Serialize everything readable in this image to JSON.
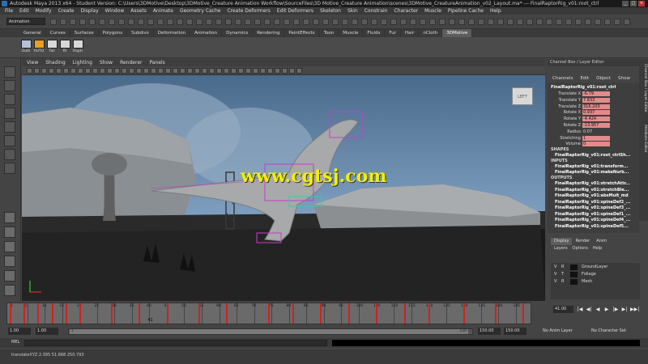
{
  "titlebar": {
    "title": "Autodesk Maya 2013 x64 - Student Version: C:\\Users\\3DMotive\\Desktop\\3DMotive_Creature Animation Workflow\\SourceFiles\\3D Motive_Creature Animation\\scenes\\3DMotive_CreatureAnimation_v02_Layout.ma* --- FinalRaptorRig_v01:root_ctrl"
  },
  "menubar": [
    "File",
    "Edit",
    "Modify",
    "Create",
    "Display",
    "Window",
    "Assets",
    "Animate",
    "Geometry Cache",
    "Create Deformers",
    "Edit Deformers",
    "Skeleton",
    "Skin",
    "Constrain",
    "Character",
    "Muscle",
    "Pipeline Cache",
    "Help"
  ],
  "statusline": {
    "mode": "Animation"
  },
  "shelf_tabs": [
    "General",
    "Curves",
    "Surfaces",
    "Polygons",
    "Subdivs",
    "Deformation",
    "Animation",
    "Dynamics",
    "Rendering",
    "PaintEffects",
    "Toon",
    "Muscle",
    "Fluids",
    "Fur",
    "Hair",
    "nCloth",
    "3DMotive"
  ],
  "shelf_active_tab": "3DMotive",
  "shelf_buttons": [
    {
      "label": "Outli",
      "color": "#b5c2d6"
    },
    {
      "label": "AUTO",
      "color": "#e8a020"
    },
    {
      "label": "Tail",
      "color": "#d8d8d8"
    },
    {
      "label": "fit",
      "color": "#d8d8d8"
    },
    {
      "label": "Rapti",
      "color": "#d8d8d8"
    }
  ],
  "viewport": {
    "menu": [
      "View",
      "Shading",
      "Lighting",
      "Show",
      "Renderer",
      "Panels"
    ],
    "view_cube_label": "LEFT",
    "watermark": "www.cgtsj.com"
  },
  "channel_box": {
    "title": "Channel Box / Layer Editor",
    "menu": [
      "Channels",
      "Edit",
      "Object",
      "Show"
    ],
    "node": "FinalRaptorRig_v01:root_ctrl",
    "attributes": [
      {
        "name": "Translate X",
        "value": "-6.79",
        "keyed": true
      },
      {
        "name": "Translate Y",
        "value": "7.833",
        "keyed": true
      },
      {
        "name": "Translate Z",
        "value": "316.203",
        "keyed": true
      },
      {
        "name": "Rotate X",
        "value": "0.937",
        "keyed": true
      },
      {
        "name": "Rotate Y",
        "value": "-4.424",
        "keyed": true
      },
      {
        "name": "Rotate Z",
        "value": "-13.957",
        "keyed": true
      },
      {
        "name": "Radius",
        "value": "0.07",
        "keyed": false
      },
      {
        "name": "Stretching",
        "value": "1",
        "keyed": true
      },
      {
        "name": "Volume",
        "value": "0",
        "keyed": true
      }
    ],
    "shapes_label": "SHAPES",
    "shapes": [
      "FinalRaptorRig_v01:root_ctrlSh..."
    ],
    "inputs_label": "INPUTS",
    "inputs": [
      "FinalRaptorRig_v01:transform...",
      "FinalRaptorRig_v01:makeNurb..."
    ],
    "outputs_label": "OUTPUTS",
    "outputs": [
      "FinalRaptorRig_v01:stretchAttr...",
      "FinalRaptorRig_v01:stretchBle...",
      "FinalRaptorRig_v01:absMult_md",
      "FinalRaptorRig_v01:spineDef2_...",
      "FinalRaptorRig_v01:spineDef3_...",
      "FinalRaptorRig_v01:spineDef1_...",
      "FinalRaptorRig_v01:spineDef4_...",
      "FinalRaptorRig_v01:spineDef5..."
    ]
  },
  "side_tabs": [
    "Channel Box / Layer Editor",
    "Attribute Editor"
  ],
  "layer_editor": {
    "tabs": [
      "Display",
      "Render",
      "Anim"
    ],
    "active_tab": "Display",
    "menu": [
      "Layers",
      "Options",
      "Help"
    ],
    "layers": [
      {
        "v": "V",
        "r": "R",
        "name": "GroundLayer"
      },
      {
        "v": "V",
        "r": "T",
        "name": "Foliage"
      },
      {
        "v": "V",
        "r": "R",
        "name": "Mesh"
      }
    ]
  },
  "timeline": {
    "start": 1,
    "end": 150,
    "tick_labels": [
      "1",
      "5",
      "10",
      "15",
      "20",
      "25",
      "30",
      "35",
      "40",
      "45",
      "50",
      "55",
      "60",
      "65",
      "70",
      "75",
      "80",
      "85",
      "90",
      "95",
      "100",
      "105",
      "110",
      "115",
      "120",
      "125",
      "130",
      "135",
      "140",
      "145",
      "150"
    ],
    "keys": [
      1,
      5,
      9,
      13,
      17,
      21,
      30,
      38,
      46,
      55,
      63,
      75,
      82,
      90,
      98,
      106,
      114,
      121,
      131,
      140,
      148
    ],
    "current_frame_marker": "41",
    "current_frame": "41.00",
    "playback_buttons": [
      "|◀",
      "◀|",
      "◀",
      "▶",
      "|▶",
      "▶|",
      "▶▶|"
    ]
  },
  "range": {
    "start_field": "1.00",
    "playback_start": "1.00",
    "slider_min": "1",
    "slider_max": "150",
    "playback_end": "150.00",
    "end_field": "150.00",
    "anim_layer": "No Anim Layer",
    "character_set": "No Character Set"
  },
  "command_line": {
    "label": "MEL"
  },
  "help_line": {
    "text": "translateXYZ     2.395     51.668     250.793"
  }
}
